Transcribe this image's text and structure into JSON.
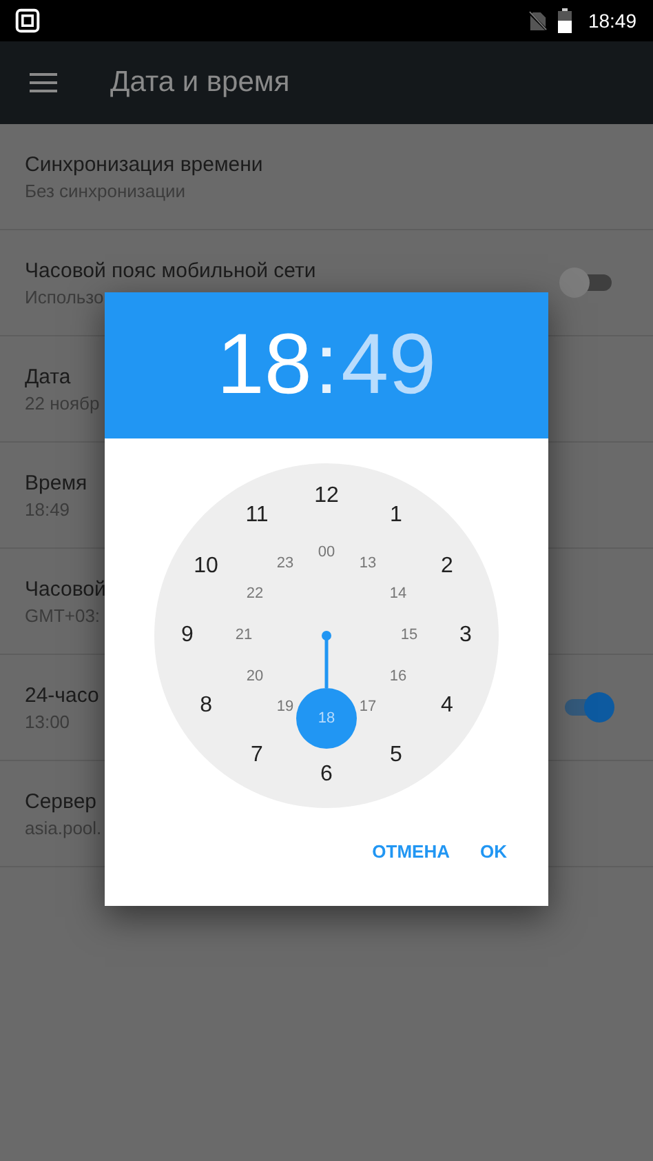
{
  "status_bar": {
    "time": "18:49"
  },
  "toolbar": {
    "title": "Дата и время"
  },
  "settings": [
    {
      "title": "Синхронизация времени",
      "summary": "Без синхронизации",
      "kind": "plain"
    },
    {
      "title": "Часовой пояс мобильной сети",
      "summary": "Использо",
      "kind": "switch",
      "on": false
    },
    {
      "title": "Дата",
      "summary": "22 ноябр",
      "kind": "plain"
    },
    {
      "title": "Время",
      "summary": "18:49",
      "kind": "plain"
    },
    {
      "title": "Часовой",
      "summary": "GMT+03:",
      "kind": "plain"
    },
    {
      "title": "24-часо",
      "summary": "13:00",
      "kind": "switch",
      "on": true
    },
    {
      "title": "Сервер",
      "summary": "asia.pool.",
      "kind": "plain"
    }
  ],
  "dialog": {
    "hours": {
      "text": "18",
      "selected": true
    },
    "separator": ":",
    "minutes": {
      "text": "49",
      "selected": false
    },
    "outer_hours": [
      {
        "label": "12",
        "selected": false
      },
      {
        "label": "1",
        "selected": false
      },
      {
        "label": "2",
        "selected": false
      },
      {
        "label": "3",
        "selected": false
      },
      {
        "label": "4",
        "selected": false
      },
      {
        "label": "5",
        "selected": false
      },
      {
        "label": "6",
        "selected": false
      },
      {
        "label": "7",
        "selected": false
      },
      {
        "label": "8",
        "selected": false
      },
      {
        "label": "9",
        "selected": false
      },
      {
        "label": "10",
        "selected": false
      },
      {
        "label": "11",
        "selected": false
      }
    ],
    "inner_hours": [
      {
        "label": "00",
        "selected": false
      },
      {
        "label": "13",
        "selected": false
      },
      {
        "label": "14",
        "selected": false
      },
      {
        "label": "15",
        "selected": false
      },
      {
        "label": "16",
        "selected": false
      },
      {
        "label": "17",
        "selected": false
      },
      {
        "label": "18",
        "selected": true
      },
      {
        "label": "19",
        "selected": false
      },
      {
        "label": "20",
        "selected": false
      },
      {
        "label": "21",
        "selected": false
      },
      {
        "label": "22",
        "selected": false
      },
      {
        "label": "23",
        "selected": false
      }
    ],
    "buttons": [
      "ОТМЕНА",
      "OK"
    ]
  }
}
